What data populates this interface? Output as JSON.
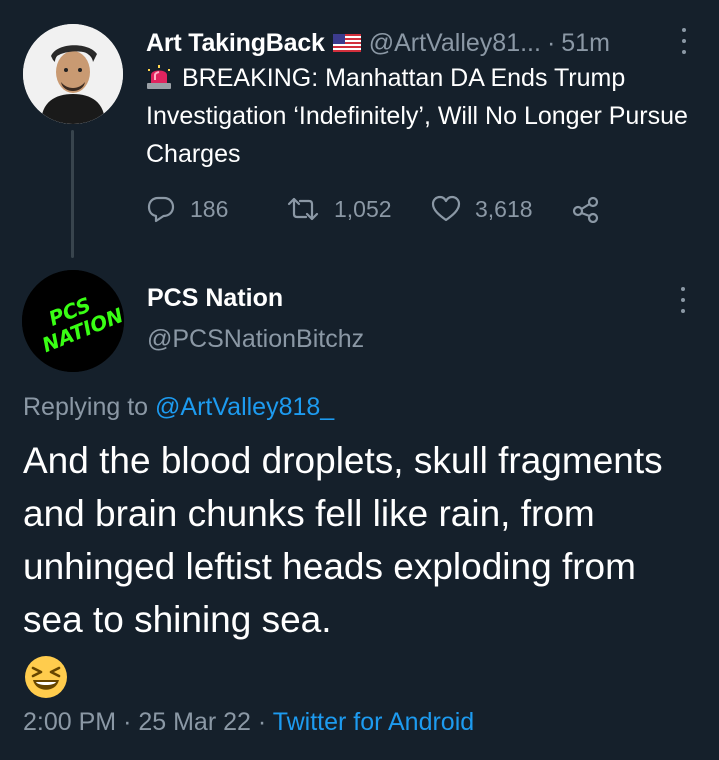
{
  "original_tweet": {
    "author_name": "Art TakingBack",
    "flag_emoji": "us-flag-icon",
    "handle": "@ArtValley81...",
    "separator": "·",
    "time": "51m",
    "text": "BREAKING: Manhattan DA Ends Trump Investigation ‘Indefinitely’, Will No Longer Pursue Charges",
    "replies": "186",
    "retweets": "1,052",
    "likes": "3,618"
  },
  "reply_tweet": {
    "author_name": "PCS Nation",
    "handle": "@PCSNationBitchz",
    "avatar_text": "PCS NATION",
    "replying_label": "Replying to",
    "replying_mention": "@ArtValley818_",
    "text": "And the blood droplets, skull fragments and brain chunks fell like rain, from unhinged leftist heads exploding from sea to shining sea.",
    "emoji": "squinting-laugh-emoji",
    "time": "2:00 PM",
    "separator": "·",
    "date": "25 Mar 22",
    "separator2": "·",
    "source": "Twitter for Android"
  },
  "colors": {
    "background": "#15202b",
    "secondary_text": "#8b98a5",
    "link": "#1d9bf0",
    "thread_line": "#38444d",
    "avatar_neon": "#39ff14"
  }
}
